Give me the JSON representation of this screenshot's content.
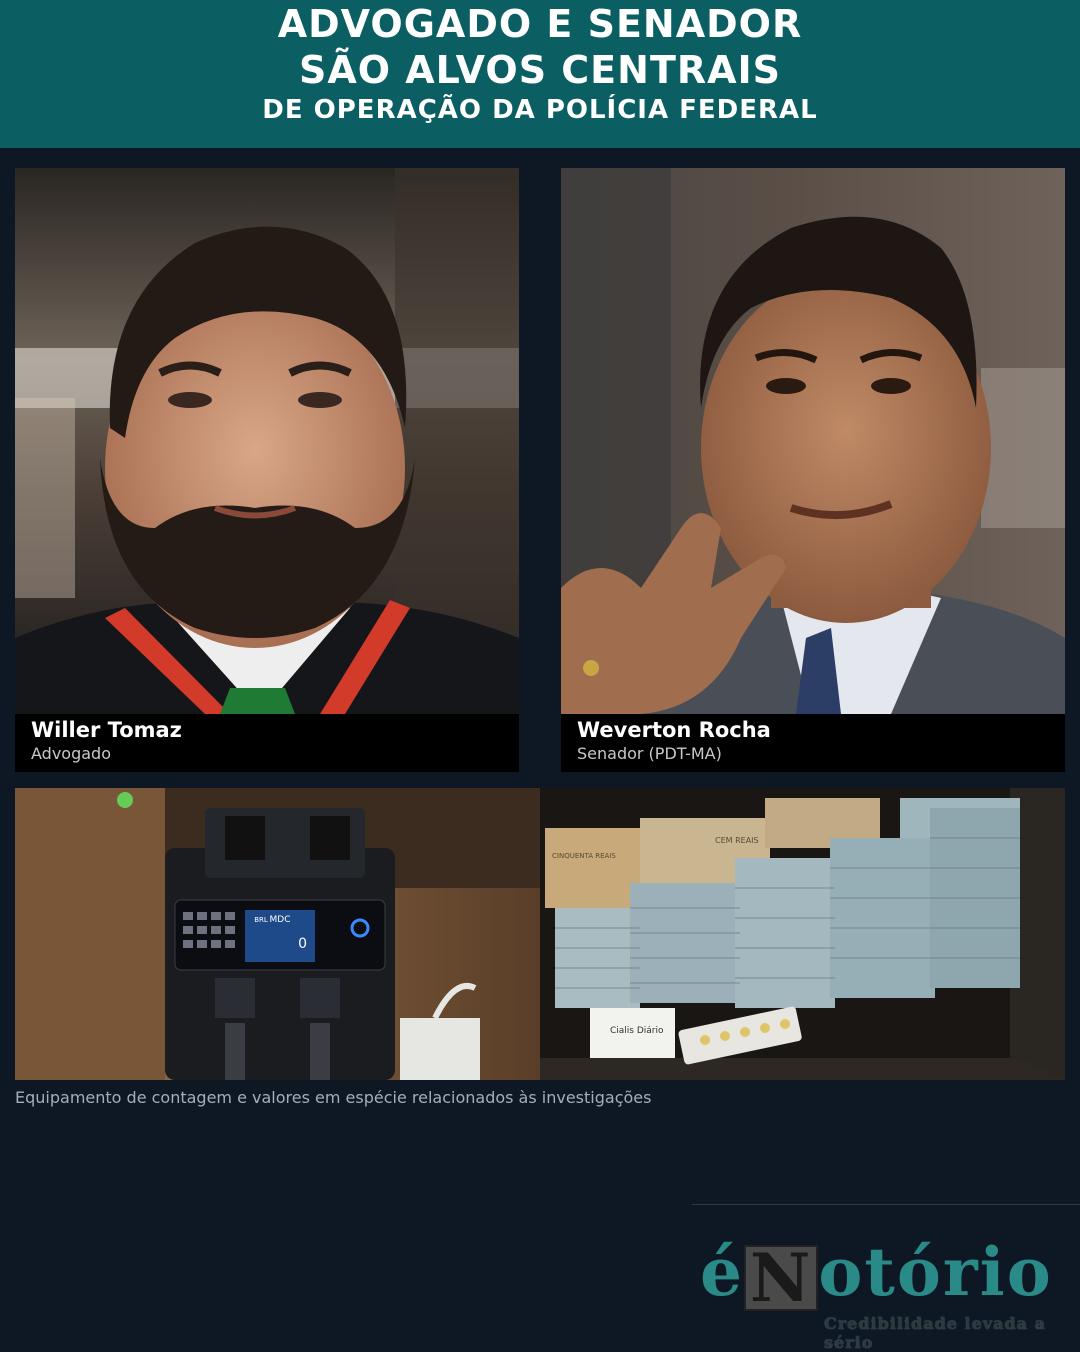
{
  "header": {
    "line1": "ADVOGADO E SENADOR",
    "line2": "SÃO ALVOS CENTRAIS",
    "line3": "DE OPERAÇÃO DA POLÍCIA FEDERAL"
  },
  "profiles": [
    {
      "name": "Willer Tomaz",
      "role": "Advogado"
    },
    {
      "name": "Weverton Rocha",
      "role": "Senador (PDT-MA)"
    }
  ],
  "evidence_caption": "Equipamento de contagem e valores em espécie relacionados às investigações",
  "counter_display": {
    "brand": "MDC",
    "currency": "BRL",
    "value": "0"
  },
  "money_labels": {
    "label1": "CEM REAIS",
    "label2": "CINQUENTA REAIS",
    "box": "Cialis Diário"
  },
  "logo": {
    "prefix": "é",
    "boxed_letter": "N",
    "suffix": "otório",
    "tagline": "Credibilidade levada a sério"
  },
  "colors": {
    "header_bg": "#0b5f62",
    "page_bg": "#0e1824",
    "logo": "#2a8a88"
  }
}
